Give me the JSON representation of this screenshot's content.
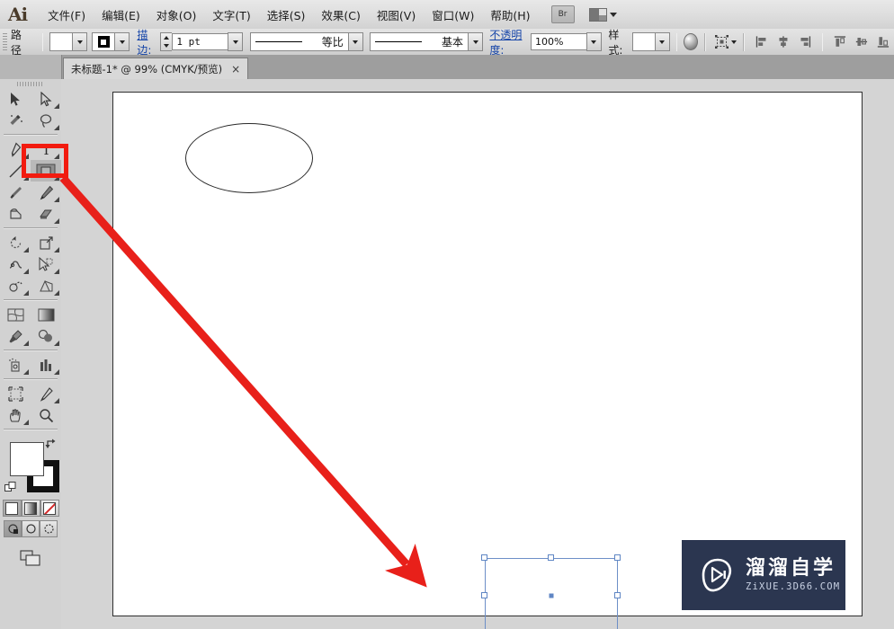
{
  "app": {
    "name": "Ai",
    "logo_icon": "illustrator-logo-icon"
  },
  "menubar": {
    "items": [
      {
        "label": "文件(F)",
        "name": "menu-file"
      },
      {
        "label": "编辑(E)",
        "name": "menu-edit"
      },
      {
        "label": "对象(O)",
        "name": "menu-object"
      },
      {
        "label": "文字(T)",
        "name": "menu-type"
      },
      {
        "label": "选择(S)",
        "name": "menu-select"
      },
      {
        "label": "效果(C)",
        "name": "menu-effect"
      },
      {
        "label": "视图(V)",
        "name": "menu-view"
      },
      {
        "label": "窗口(W)",
        "name": "menu-window"
      },
      {
        "label": "帮助(H)",
        "name": "menu-help"
      }
    ],
    "bridge_label": "Br",
    "workspace_icon": "workspace-switcher-icon"
  },
  "controlbar": {
    "context_label": "路径",
    "fill_swatch_value": "#ffffff",
    "stroke_swatch_value": "#000000",
    "stroke_label": "描边:",
    "stroke_weight": "1 pt",
    "stroke_profile_label": "等比",
    "brush_label": "基本",
    "opacity_label": "不透明度:",
    "opacity_value": "100%",
    "style_label": "样式:",
    "icons": [
      {
        "name": "gradient-orb-icon"
      },
      {
        "name": "transform-anchor-icon"
      },
      {
        "name": "align-left-icon"
      },
      {
        "name": "align-center-horizontal-icon"
      },
      {
        "name": "align-right-icon"
      },
      {
        "name": "align-top-icon"
      },
      {
        "name": "align-middle-vertical-icon"
      },
      {
        "name": "align-bottom-icon"
      }
    ]
  },
  "tabbar": {
    "document_title": "未标题-1* @ 99% (CMYK/预览)",
    "close_glyph": "×"
  },
  "toolbar": {
    "tools": [
      {
        "name": "selection-tool",
        "row": 0,
        "col": 0
      },
      {
        "name": "direct-selection-tool",
        "row": 0,
        "col": 1
      },
      {
        "name": "magic-wand-tool",
        "row": 1,
        "col": 0
      },
      {
        "name": "lasso-tool",
        "row": 1,
        "col": 1
      },
      {
        "name": "pen-tool",
        "row": 2,
        "col": 0
      },
      {
        "name": "type-tool",
        "row": 2,
        "col": 1
      },
      {
        "name": "line-segment-tool",
        "row": 3,
        "col": 0
      },
      {
        "name": "rectangle-tool",
        "row": 3,
        "col": 1,
        "selected": true
      },
      {
        "name": "paintbrush-tool",
        "row": 4,
        "col": 0
      },
      {
        "name": "pencil-tool",
        "row": 4,
        "col": 1
      },
      {
        "name": "blob-brush-tool",
        "row": 5,
        "col": 0
      },
      {
        "name": "eraser-tool",
        "row": 5,
        "col": 1
      },
      {
        "name": "rotate-tool",
        "row": 6,
        "col": 0
      },
      {
        "name": "scale-tool",
        "row": 6,
        "col": 1
      },
      {
        "name": "width-tool",
        "row": 7,
        "col": 0
      },
      {
        "name": "free-transform-tool",
        "row": 7,
        "col": 1
      },
      {
        "name": "shape-builder-tool",
        "row": 8,
        "col": 0
      },
      {
        "name": "perspective-grid-tool",
        "row": 8,
        "col": 1
      },
      {
        "name": "mesh-tool",
        "row": 9,
        "col": 0
      },
      {
        "name": "gradient-tool",
        "row": 9,
        "col": 1
      },
      {
        "name": "eyedropper-tool",
        "row": 10,
        "col": 0
      },
      {
        "name": "blend-tool",
        "row": 10,
        "col": 1
      },
      {
        "name": "symbol-sprayer-tool",
        "row": 11,
        "col": 0
      },
      {
        "name": "column-graph-tool",
        "row": 11,
        "col": 1
      },
      {
        "name": "artboard-tool",
        "row": 12,
        "col": 0
      },
      {
        "name": "slice-tool",
        "row": 12,
        "col": 1
      },
      {
        "name": "hand-tool",
        "row": 13,
        "col": 0
      },
      {
        "name": "zoom-tool",
        "row": 13,
        "col": 1
      }
    ],
    "fill_color": "#ffffff",
    "stroke_color": "#000000",
    "swap_icon": "swap-fill-stroke-icon",
    "default_icon": "default-fill-stroke-icon",
    "paint_modes": [
      {
        "name": "color-mode-button",
        "active": false
      },
      {
        "name": "gradient-mode-button",
        "active": false
      },
      {
        "name": "none-mode-button",
        "active": false
      }
    ],
    "screen_modes": [
      {
        "name": "normal-screen-mode-button",
        "active": true
      },
      {
        "name": "fullscreen-menubar-mode-button",
        "active": false
      },
      {
        "name": "fullscreen-mode-button",
        "active": false
      }
    ],
    "change_screen_mode_icon": "change-screen-mode-icon"
  },
  "canvas": {
    "background_color": "#d4d4d4",
    "artboard_color": "#ffffff",
    "shapes": [
      {
        "name": "ellipse-shape",
        "type": "ellipse",
        "stroke": "#2a2a2a",
        "fill": "none"
      },
      {
        "name": "rectangle-shape",
        "type": "rectangle",
        "selected": true,
        "selection_color": "#6d8fc7"
      }
    ]
  },
  "annotations": {
    "highlight_box": {
      "name": "tool-highlight-box",
      "color": "#f21b0f"
    },
    "arrow": {
      "name": "pointer-arrow",
      "color": "#e8201a"
    }
  },
  "watermark": {
    "title": "溜溜自学",
    "subtitle": "ZiXUE.3D66.COM",
    "logo_icon": "play-triangle-logo-icon",
    "background_color": "#2b3650"
  }
}
